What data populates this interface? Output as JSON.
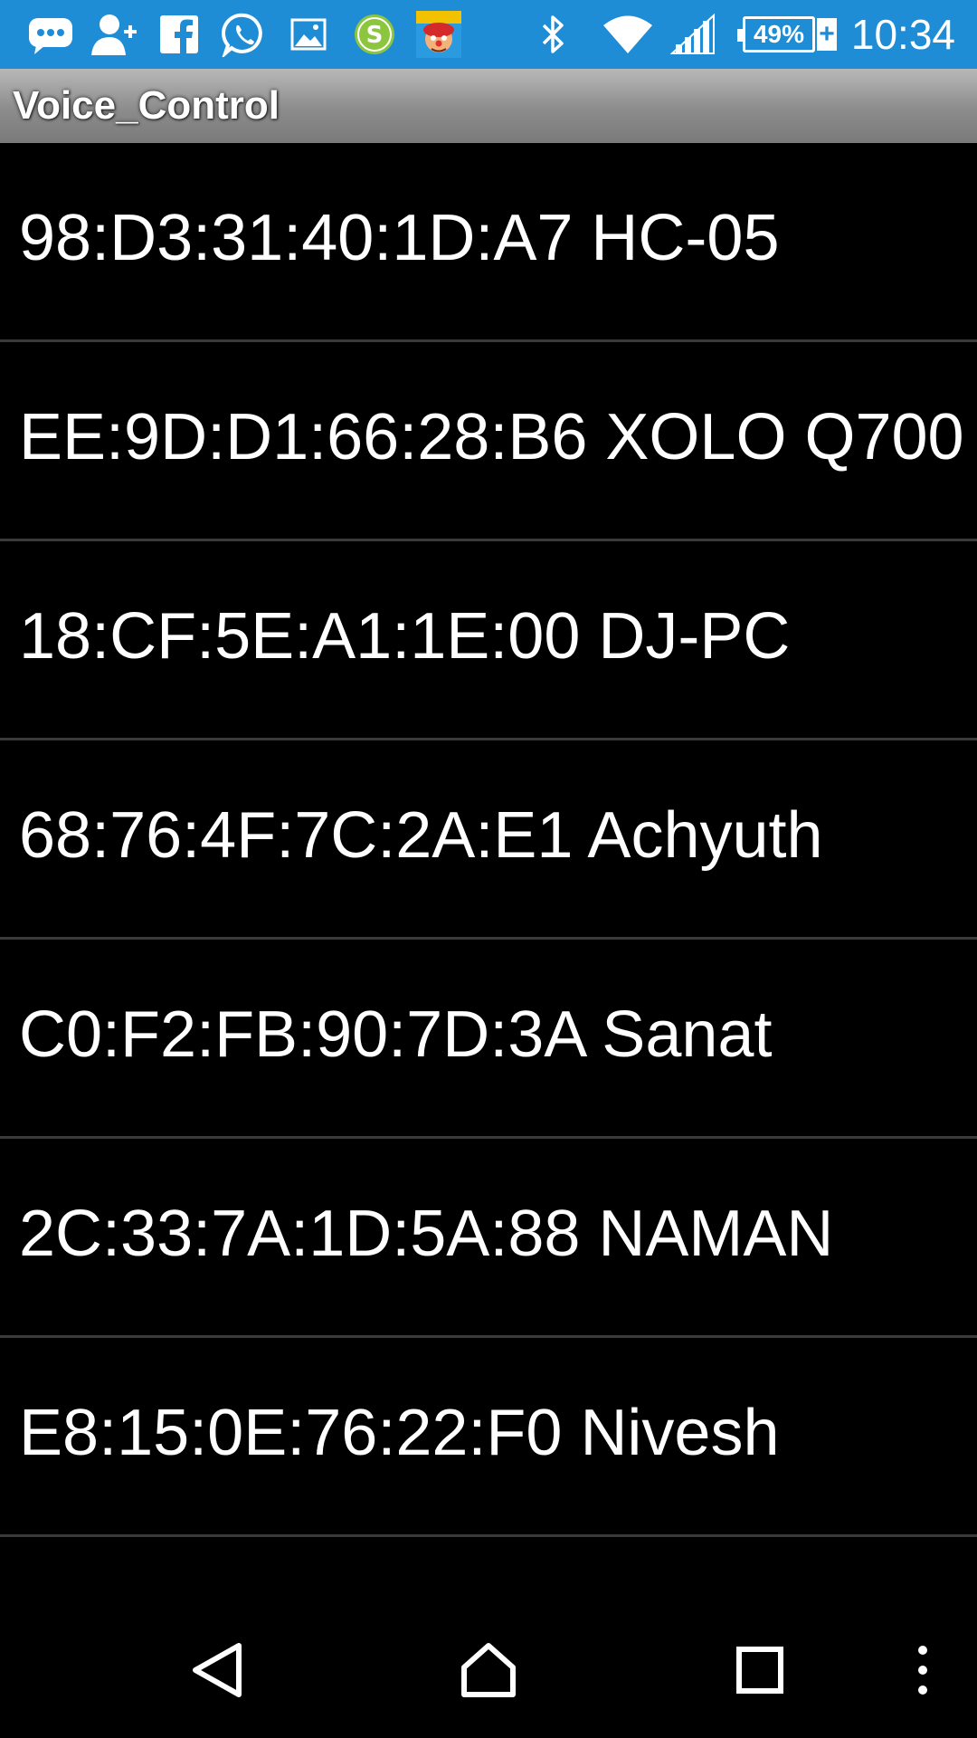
{
  "status_bar": {
    "clock": "10:34",
    "battery_percent": "49%",
    "icons": [
      "messenger-icon",
      "add-contact-icon",
      "facebook-icon",
      "whatsapp-icon",
      "gallery-icon",
      "s-app-icon",
      "game-app-icon",
      "bluetooth-icon",
      "wifi-icon",
      "signal-icon",
      "battery-icon"
    ],
    "background_color": "#1f8dd6"
  },
  "title_bar": {
    "title": "Voice_Control"
  },
  "devices": [
    {
      "label": "98:D3:31:40:1D:A7 HC-05"
    },
    {
      "label": "EE:9D:D1:66:28:B6 XOLO Q700"
    },
    {
      "label": "18:CF:5E:A1:1E:00 DJ-PC"
    },
    {
      "label": "68:76:4F:7C:2A:E1 Achyuth"
    },
    {
      "label": "C0:F2:FB:90:7D:3A Sanat"
    },
    {
      "label": "2C:33:7A:1D:5A:88 NAMAN"
    },
    {
      "label": "E8:15:0E:76:22:F0 Nivesh"
    }
  ],
  "nav_bar": {
    "buttons": [
      "back-icon",
      "home-icon",
      "recents-icon",
      "overflow-menu-icon"
    ]
  }
}
